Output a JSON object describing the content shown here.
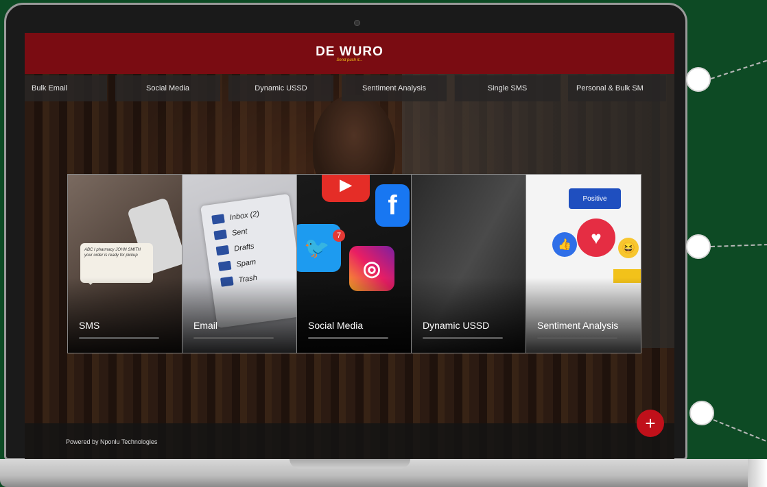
{
  "app": {
    "logo_text": "DE WURO",
    "logo_tagline": "Send push it..."
  },
  "nav": {
    "items": [
      {
        "label": "Bulk Email"
      },
      {
        "label": "Social Media"
      },
      {
        "label": "Dynamic USSD"
      },
      {
        "label": "Sentiment Analysis"
      },
      {
        "label": "Single SMS"
      },
      {
        "label": "Personal & Bulk SM"
      }
    ]
  },
  "cards": [
    {
      "label": "SMS",
      "bubble_text": "ABC I pharmacy JOHN SMITH your order is ready for pickup"
    },
    {
      "label": "Email",
      "folders": [
        "Inbox (2)",
        "Sent",
        "Drafts",
        "Spam",
        "Trash"
      ]
    },
    {
      "label": "Social Media",
      "apps": [
        "YouTube",
        "Facebook",
        "Twitter",
        "Instagram"
      ],
      "badge": "7"
    },
    {
      "label": "Dynamic USSD"
    },
    {
      "label": "Sentiment Analysis",
      "positive_label": "Positive"
    }
  ],
  "footer": {
    "text": "Powered by Nponlu Technologies"
  },
  "fab": {
    "icon": "plus-icon",
    "glyph": "+"
  },
  "colors": {
    "background": "#0d4a24",
    "header": "#7a0c12",
    "fab": "#c0101a",
    "accent_gold": "#f2c21a"
  }
}
